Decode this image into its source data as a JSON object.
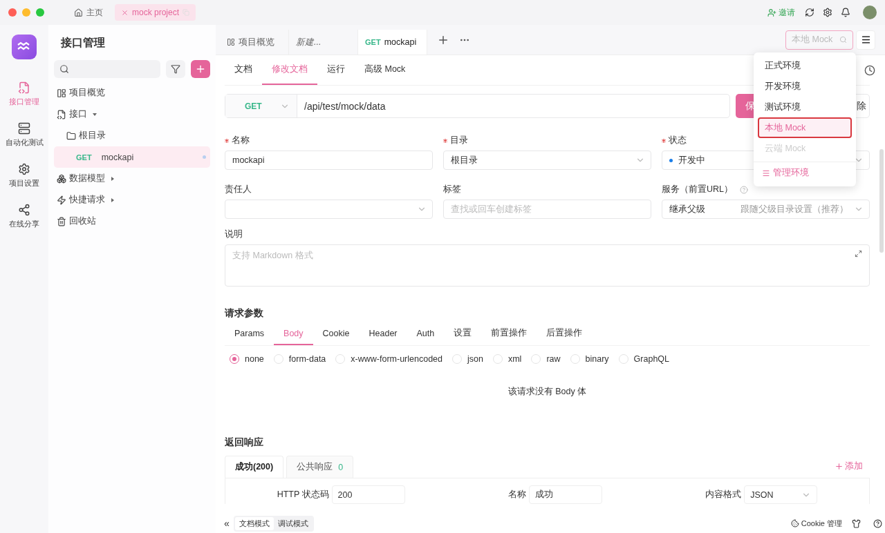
{
  "window_tabs": [
    {
      "kind": "home",
      "label": "主页",
      "selected": false
    },
    {
      "kind": "project",
      "label": "mock project",
      "selected": true
    }
  ],
  "top_actions": {
    "invite": "邀请"
  },
  "rail": [
    {
      "kind": "api",
      "label": "接口管理",
      "selected": true
    },
    {
      "kind": "auto",
      "label": "自动化测试",
      "selected": false
    },
    {
      "kind": "settings",
      "label": "项目设置",
      "selected": false
    },
    {
      "kind": "share",
      "label": "在线分享",
      "selected": false
    }
  ],
  "sidebar": {
    "title": "接口管理",
    "tree": [
      {
        "kind": "overview",
        "label": "项目概览",
        "selected": false
      },
      {
        "kind": "api",
        "label": "接口",
        "expanded": true,
        "selected": false,
        "children": [
          {
            "kind": "folder",
            "label": "根目录",
            "selected": false,
            "children": [
              {
                "kind": "endpoint",
                "method": "GET",
                "label": "mockapi",
                "selected": true
              }
            ]
          }
        ]
      },
      {
        "kind": "model",
        "label": "数据模型",
        "expanded": false,
        "selected": false
      },
      {
        "kind": "quick",
        "label": "快捷请求",
        "expanded": false,
        "selected": false
      },
      {
        "kind": "trash",
        "label": "回收站",
        "selected": false
      }
    ]
  },
  "tabs": [
    {
      "kind": "overview",
      "label": "项目概览",
      "selected": false
    },
    {
      "kind": "draft",
      "label": "新建...",
      "selected": false
    },
    {
      "kind": "endpoint",
      "method": "GET",
      "label": "mockapi",
      "selected": true
    }
  ],
  "env": {
    "placeholder": "本地 Mock",
    "menu": [
      {
        "label": "正式环境",
        "selected": false,
        "disabled": false
      },
      {
        "label": "开发环境",
        "selected": false,
        "disabled": false
      },
      {
        "label": "测试环境",
        "selected": false,
        "disabled": false
      },
      {
        "label": "本地 Mock",
        "selected": true,
        "disabled": false
      },
      {
        "label": "云端 Mock",
        "selected": false,
        "disabled": true
      }
    ],
    "manage": "管理环境"
  },
  "subtabs": [
    {
      "label": "文档",
      "selected": false
    },
    {
      "label": "修改文档",
      "selected": true
    },
    {
      "label": "运行",
      "selected": false
    },
    {
      "label": "高级 Mock",
      "selected": false
    }
  ],
  "request": {
    "method": "GET",
    "url": "/api/test/mock/data",
    "save": "保",
    "delete": "除"
  },
  "fields": [
    {
      "kind": "input",
      "label": "名称",
      "required": true,
      "value": "mockapi"
    },
    {
      "kind": "select",
      "label": "目录",
      "required": true,
      "value": "根目录"
    },
    {
      "kind": "status",
      "label": "状态",
      "required": true,
      "value": "开发中",
      "color": "#1a7ee8"
    },
    {
      "kind": "select",
      "label": "责任人"
    },
    {
      "kind": "input",
      "label": "标签",
      "placeholder": "查找或回车创建标签"
    },
    {
      "kind": "service",
      "label": "服务（前置URL）",
      "value": "继承父级",
      "hint": "跟随父级目录设置（推荐）"
    }
  ],
  "description": {
    "label": "说明",
    "placeholder": "支持 Markdown 格式"
  },
  "params": {
    "title": "请求参数",
    "tabs": [
      {
        "label": "Params",
        "selected": false
      },
      {
        "label": "Body",
        "selected": true
      },
      {
        "label": "Cookie",
        "selected": false
      },
      {
        "label": "Header",
        "selected": false
      },
      {
        "label": "Auth",
        "selected": false
      },
      {
        "label": "设置",
        "selected": false
      },
      {
        "label": "前置操作",
        "selected": false
      },
      {
        "label": "后置操作",
        "selected": false
      }
    ],
    "body_types": [
      {
        "label": "none",
        "selected": true
      },
      {
        "label": "form-data",
        "selected": false
      },
      {
        "label": "x-www-form-urlencoded",
        "selected": false
      },
      {
        "label": "json",
        "selected": false
      },
      {
        "label": "xml",
        "selected": false
      },
      {
        "label": "raw",
        "selected": false
      },
      {
        "label": "binary",
        "selected": false
      },
      {
        "label": "GraphQL",
        "selected": false
      }
    ],
    "empty": "该请求没有 Body 体"
  },
  "response": {
    "title": "返回响应",
    "tabs": [
      {
        "label": "成功(200)",
        "selected": true
      },
      {
        "label": "公共响应",
        "count": "0",
        "selected": false
      }
    ],
    "add": "添加",
    "fields": [
      {
        "kind": "input",
        "label": "HTTP 状态码",
        "value": "200"
      },
      {
        "kind": "input",
        "label": "名称",
        "value": "成功"
      },
      {
        "kind": "select",
        "label": "内容格式",
        "value": "JSON"
      }
    ]
  },
  "footer": {
    "collapse": "«",
    "modes": [
      {
        "label": "文档模式",
        "selected": true
      },
      {
        "label": "调试模式",
        "selected": false
      }
    ],
    "cookie": "Cookie 管理"
  }
}
